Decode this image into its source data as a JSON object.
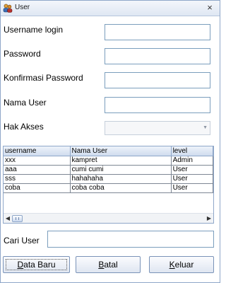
{
  "window": {
    "title": "User",
    "close_glyph": "×",
    "app_icon": "users-icon"
  },
  "form": {
    "username_label": "Username login",
    "username_value": "",
    "password_label": "Password",
    "password_value": "",
    "confirm_label": "Konfirmasi Password",
    "confirm_value": "",
    "nama_label": "Nama User",
    "nama_value": "",
    "hak_label": "Hak Akses",
    "hak_value": "",
    "hak_arrow": "▼"
  },
  "table": {
    "columns": [
      "username",
      "Nama User",
      "level"
    ],
    "rows": [
      [
        "xxx",
        "kampret",
        "Admin"
      ],
      [
        "aaa",
        "cumi cumi",
        "User"
      ],
      [
        "sss",
        "hahahaha",
        "User"
      ],
      [
        "coba",
        "coba coba",
        "User"
      ]
    ],
    "scroll_left": "◀",
    "scroll_right": "▶"
  },
  "search": {
    "label": "Cari User",
    "value": ""
  },
  "buttons": {
    "new": {
      "before": "",
      "mnemonic": "D",
      "after": "ata Baru"
    },
    "cancel": {
      "before": "",
      "mnemonic": "B",
      "after": "atal"
    },
    "exit": {
      "before": "",
      "mnemonic": "K",
      "after": "eluar"
    }
  }
}
